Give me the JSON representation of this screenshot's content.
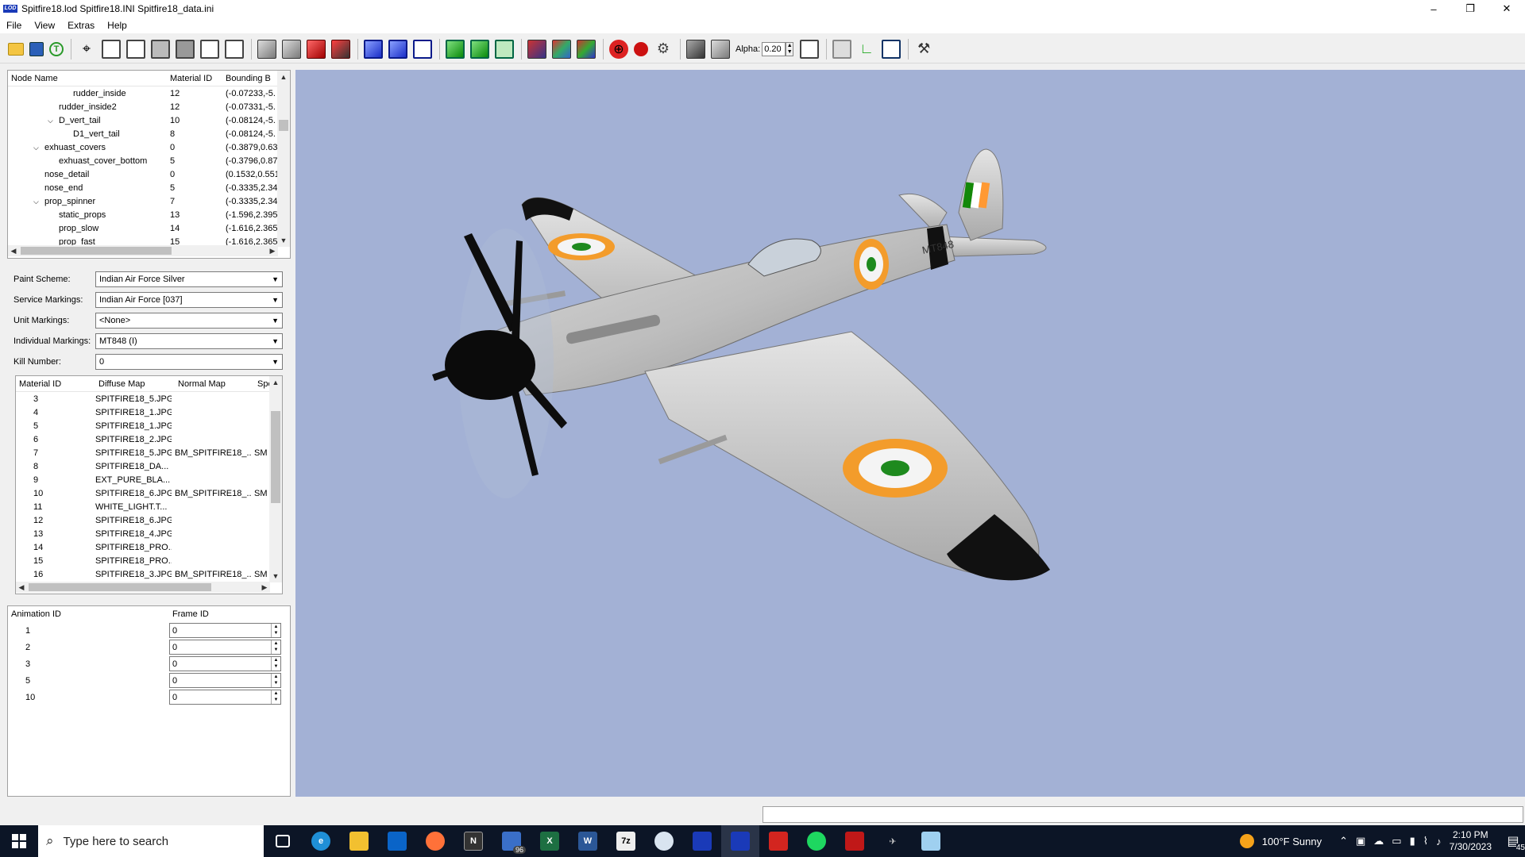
{
  "window": {
    "title": "Spitfire18.lod  Spitfire18.INI  Spitfire18_data.ini",
    "logo_text": "LOD"
  },
  "menu": [
    "File",
    "View",
    "Extras",
    "Help"
  ],
  "toolbar": {
    "alpha_label": "Alpha:",
    "alpha_value": "0.20"
  },
  "node_tree": {
    "headers": [
      "Node Name",
      "Material ID",
      "Bounding B"
    ],
    "rows": [
      {
        "name": "rudder_inside",
        "material": "12",
        "bounds": "(-0.07233,-5."
      },
      {
        "name": "rudder_inside2",
        "material": "12",
        "bounds": "(-0.07331,-5."
      },
      {
        "name": "D_vert_tail",
        "material": "10",
        "bounds": "(-0.08124,-5."
      },
      {
        "name": "D1_vert_tail",
        "material": "8",
        "bounds": "(-0.08124,-5."
      },
      {
        "name": "exhuast_covers",
        "material": "0",
        "bounds": "(-0.3879,0.63"
      },
      {
        "name": "exhuast_cover_bottom",
        "material": "5",
        "bounds": "(-0.3796,0.87"
      },
      {
        "name": "nose_detail",
        "material": "0",
        "bounds": "(0.1532,0.551"
      },
      {
        "name": "nose_end",
        "material": "5",
        "bounds": "(-0.3335,2.34"
      },
      {
        "name": "prop_spinner",
        "material": "7",
        "bounds": "(-0.3335,2.34"
      },
      {
        "name": "static_props",
        "material": "13",
        "bounds": "(-1.596,2.395"
      },
      {
        "name": "prop_slow",
        "material": "14",
        "bounds": "(-1.616,2.365"
      },
      {
        "name": "prop_fast",
        "material": "15",
        "bounds": "(-1.616,2.365"
      }
    ]
  },
  "markings": {
    "paint_scheme_label": "Paint Scheme:",
    "paint_scheme": "Indian Air Force Silver",
    "service_label": "Service Markings:",
    "service": "Indian Air Force [037]",
    "unit_label": "Unit Markings:",
    "unit": "<None>",
    "individual_label": "Individual Markings:",
    "individual": "MT848 (I)",
    "kill_label": "Kill Number:",
    "kill": "0"
  },
  "materials": {
    "headers": [
      "Material ID",
      "Diffuse Map",
      "Normal Map",
      "Spe"
    ],
    "rows": [
      {
        "id": "3",
        "diffuse": "SPITFIRE18_5.JPG",
        "normal": "",
        "spec": ""
      },
      {
        "id": "4",
        "diffuse": "SPITFIRE18_1.JPG",
        "normal": "",
        "spec": ""
      },
      {
        "id": "5",
        "diffuse": "SPITFIRE18_1.JPG",
        "normal": "",
        "spec": ""
      },
      {
        "id": "6",
        "diffuse": "SPITFIRE18_2.JPG",
        "normal": "",
        "spec": ""
      },
      {
        "id": "7",
        "diffuse": "SPITFIRE18_5.JPG",
        "normal": "BM_SPITFIRE18_...",
        "spec": "SM"
      },
      {
        "id": "8",
        "diffuse": "SPITFIRE18_DA...",
        "normal": "",
        "spec": ""
      },
      {
        "id": "9",
        "diffuse": "EXT_PURE_BLA...",
        "normal": "",
        "spec": ""
      },
      {
        "id": "10",
        "diffuse": "SPITFIRE18_6.JPG",
        "normal": "BM_SPITFIRE18_...",
        "spec": "SM"
      },
      {
        "id": "11",
        "diffuse": "WHITE_LIGHT.T...",
        "normal": "",
        "spec": ""
      },
      {
        "id": "12",
        "diffuse": "SPITFIRE18_6.JPG",
        "normal": "",
        "spec": ""
      },
      {
        "id": "13",
        "diffuse": "SPITFIRE18_4.JPG",
        "normal": "",
        "spec": ""
      },
      {
        "id": "14",
        "diffuse": "SPITFIRE18_PRO...",
        "normal": "",
        "spec": ""
      },
      {
        "id": "15",
        "diffuse": "SPITFIRE18_PRO...",
        "normal": "",
        "spec": ""
      },
      {
        "id": "16",
        "diffuse": "SPITFIRE18_3.JPG",
        "normal": "BM_SPITFIRE18_...",
        "spec": "SM"
      }
    ]
  },
  "animations": {
    "headers": [
      "Animation ID",
      "Frame ID"
    ],
    "rows": [
      {
        "id": "1",
        "frame": "0"
      },
      {
        "id": "2",
        "frame": "0"
      },
      {
        "id": "3",
        "frame": "0"
      },
      {
        "id": "5",
        "frame": "0"
      },
      {
        "id": "10",
        "frame": "0"
      }
    ]
  },
  "viewport": {
    "serial": "MT848",
    "background": "#a3b1d5"
  },
  "taskbar": {
    "search_placeholder": "Type here to search",
    "mail_badge": "96",
    "weather": "100°F  Sunny",
    "time": "2:10 PM",
    "date": "7/30/2023",
    "notification_count": "45"
  }
}
